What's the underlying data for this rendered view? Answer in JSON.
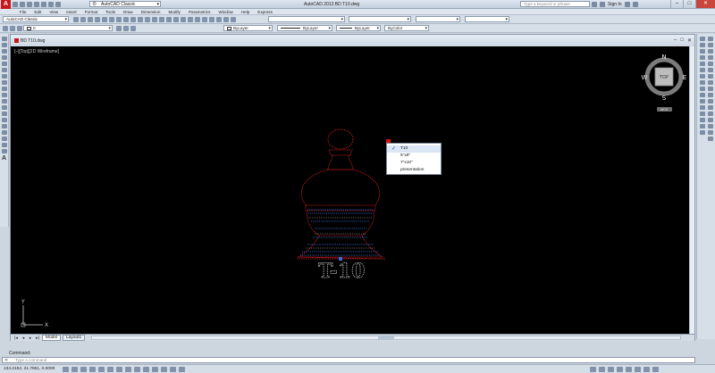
{
  "window": {
    "title": "AutoCAD 2013    BD T10.dwg",
    "workspace": "AutoCAD Classic",
    "search_placeholder": "Type a keyword or phrase",
    "sign_in": "Sign In"
  },
  "menu": [
    "File",
    "Edit",
    "View",
    "Insert",
    "Format",
    "Tools",
    "Draw",
    "Dimension",
    "Modify",
    "Parametrics",
    "Window",
    "Help",
    "Express"
  ],
  "toolbar": {
    "workspace_combo": "AutoCAD Classic",
    "layer_combo": "0",
    "color_combo": "ByLayer",
    "linetype_combo": "ByLayer",
    "lineweight_combo": "ByLayer",
    "plotstyle_combo": "ByColor"
  },
  "document": {
    "tab": "BD T10.dwg",
    "viewport_label": "[–][Top][2D Wireframe]"
  },
  "viewcube": {
    "face": "TOP",
    "north": "N",
    "south": "S",
    "east": "E",
    "west": "W",
    "wcs": "WCS"
  },
  "drawing": {
    "label_text": "T-10",
    "outline_color": "#cc1f1f",
    "detail_color": "#3b6fd8"
  },
  "context_menu": {
    "items": [
      {
        "label": "T10",
        "checked": true
      },
      {
        "label": "5\"x8\"",
        "checked": false
      },
      {
        "label": "7\"x10\"",
        "checked": false
      },
      {
        "label": "presentation",
        "checked": false
      }
    ]
  },
  "layout_tabs": [
    "Model",
    "Layout1"
  ],
  "ucs": {
    "x": "X",
    "y": "Y"
  },
  "command": {
    "history": "Command:",
    "placeholder": "Type a command"
  },
  "status": {
    "coords": "134.2152, 21.7851, 0.0000"
  }
}
